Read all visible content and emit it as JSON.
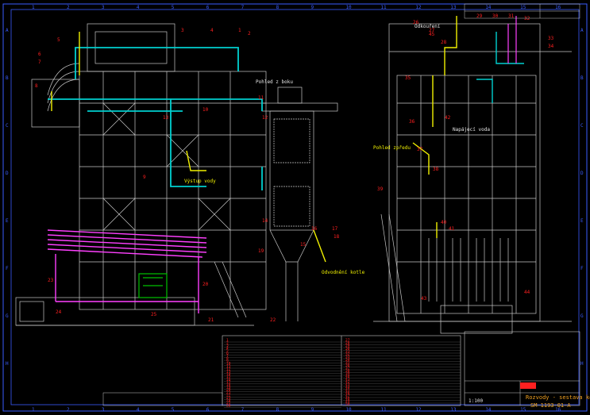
{
  "frame": {
    "columns": [
      "1",
      "2",
      "3",
      "4",
      "5",
      "6",
      "7",
      "8",
      "9",
      "10",
      "11",
      "12",
      "13",
      "14",
      "15",
      "16"
    ],
    "rows": [
      "A",
      "B",
      "C",
      "D",
      "E",
      "F",
      "G",
      "H"
    ]
  },
  "title_block": {
    "sheet_title": "Rozvody - sestava kotle",
    "sheet_no": "SM 1193-01-A",
    "scale": "1:100"
  },
  "legend_left": [
    "1",
    "2",
    "3",
    "4",
    "5",
    "6",
    "7",
    "8",
    "9",
    "10",
    "11",
    "12",
    "13",
    "14",
    "15",
    "16",
    "17",
    "18",
    "19",
    "20",
    "21",
    "22",
    "23",
    "24",
    "25",
    "26"
  ],
  "legend_right": [
    "27",
    "28",
    "29",
    "30",
    "31",
    "32",
    "33",
    "34",
    "35",
    "36",
    "37",
    "38",
    "39",
    "40",
    "41",
    "42",
    "43",
    "44",
    "45",
    "46",
    "47",
    "48",
    "49",
    "50"
  ],
  "callouts_left_view": [
    {
      "label": "1"
    },
    {
      "label": "2"
    },
    {
      "label": "3"
    },
    {
      "label": "4"
    },
    {
      "label": "5"
    },
    {
      "label": "6"
    },
    {
      "label": "7"
    },
    {
      "label": "8"
    },
    {
      "label": "9"
    },
    {
      "label": "10"
    },
    {
      "label": "11"
    },
    {
      "label": "12"
    },
    {
      "label": "13"
    },
    {
      "label": "14"
    },
    {
      "label": "15"
    },
    {
      "label": "16"
    },
    {
      "label": "17"
    },
    {
      "label": "18"
    },
    {
      "label": "19"
    },
    {
      "label": "20"
    },
    {
      "label": "21"
    },
    {
      "label": "22"
    },
    {
      "label": "23"
    },
    {
      "label": "24"
    },
    {
      "label": "25"
    }
  ],
  "callouts_right_view": [
    {
      "label": "26"
    },
    {
      "label": "27"
    },
    {
      "label": "28"
    },
    {
      "label": "29"
    },
    {
      "label": "30"
    },
    {
      "label": "31"
    },
    {
      "label": "32"
    },
    {
      "label": "33"
    },
    {
      "label": "34"
    },
    {
      "label": "35"
    },
    {
      "label": "36"
    },
    {
      "label": "37"
    },
    {
      "label": "38"
    },
    {
      "label": "39"
    },
    {
      "label": "40"
    },
    {
      "label": "41"
    },
    {
      "label": "42"
    },
    {
      "label": "43"
    },
    {
      "label": "44"
    },
    {
      "label": "45"
    }
  ],
  "notes": {
    "n1": "Pohled z boku",
    "n2": "Odvodnění kotle",
    "n3": "Výstup vody",
    "n4": "Odkouření",
    "n5": "Pohled zpředu",
    "n6": "Napájecí voda"
  },
  "colors": {
    "structure": "#c8c8c8",
    "pipe_cyan": "#00d0d0",
    "pipe_magenta": "#ff40ff",
    "pipe_yellow": "#f0f000",
    "callout_red": "#ff2020",
    "frame_blue": "#3a5cff",
    "green": "#00c000",
    "text": "#e8e8e8"
  }
}
